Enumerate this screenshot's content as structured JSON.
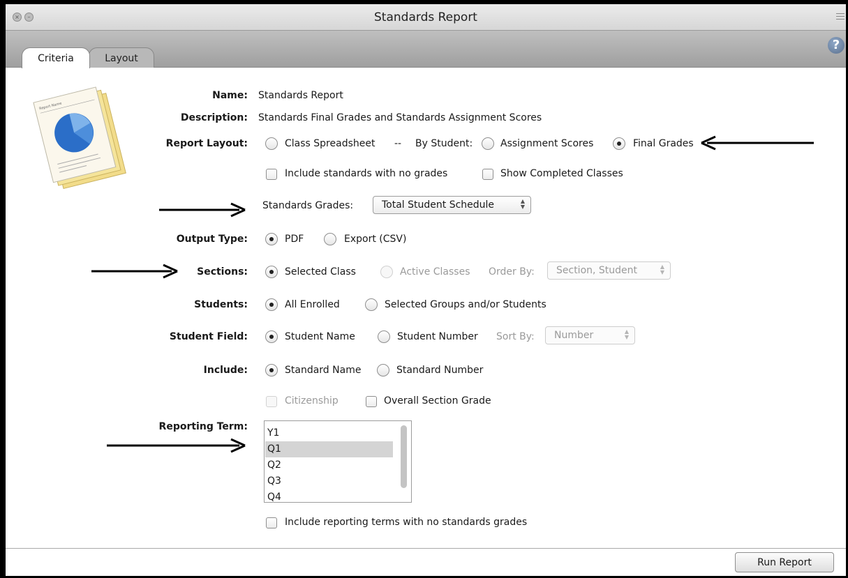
{
  "window": {
    "title": "Standards Report"
  },
  "tabs": [
    {
      "label": "Criteria"
    },
    {
      "label": "Layout"
    }
  ],
  "help": {
    "glyph": "?"
  },
  "form": {
    "name": {
      "label": "Name:",
      "value": "Standards Report"
    },
    "description": {
      "label": "Description:",
      "value": "Standards Final Grades and Standards Assignment Scores"
    },
    "report_layout": {
      "label": "Report Layout:",
      "opt_class_spreadsheet": "Class Spreadsheet",
      "separator": "--",
      "by_student": "By Student:",
      "opt_assignment_scores": "Assignment Scores",
      "opt_final_grades": "Final Grades",
      "selected": "Final Grades"
    },
    "checkboxes_1": {
      "include_no_grades": "Include standards with no grades",
      "show_completed": "Show Completed Classes"
    },
    "standards_grades": {
      "label": "Standards Grades:",
      "value": "Total Student Schedule"
    },
    "output_type": {
      "label": "Output Type:",
      "opt_pdf": "PDF",
      "opt_export": "Export (CSV)",
      "selected": "PDF"
    },
    "sections": {
      "label": "Sections:",
      "opt_selected": "Selected Class",
      "opt_active": "Active Classes",
      "order_by_label": "Order By:",
      "order_by_value": "Section, Student",
      "selected": "Selected Class"
    },
    "students": {
      "label": "Students:",
      "opt_all": "All Enrolled",
      "opt_groups": "Selected Groups and/or Students",
      "selected": "All Enrolled"
    },
    "student_field": {
      "label": "Student Field:",
      "opt_name": "Student Name",
      "opt_number": "Student Number",
      "sort_by_label": "Sort By:",
      "sort_by_value": "Number",
      "selected": "Student Name"
    },
    "include": {
      "label": "Include:",
      "opt_std_name": "Standard Name",
      "opt_std_number": "Standard Number",
      "selected": "Standard Name"
    },
    "checkboxes_2": {
      "citizenship": "Citizenship",
      "overall_grade": "Overall Section Grade"
    },
    "reporting_term": {
      "label": "Reporting Term:",
      "items": [
        "Y1",
        "Q1",
        "Q2",
        "Q3",
        "Q4"
      ],
      "selected": "Q1"
    },
    "include_terms_no_grades": "Include reporting terms with no standards grades"
  },
  "footer": {
    "run_label": "Run Report"
  },
  "icon_thumb": {
    "title": "Report Name"
  }
}
